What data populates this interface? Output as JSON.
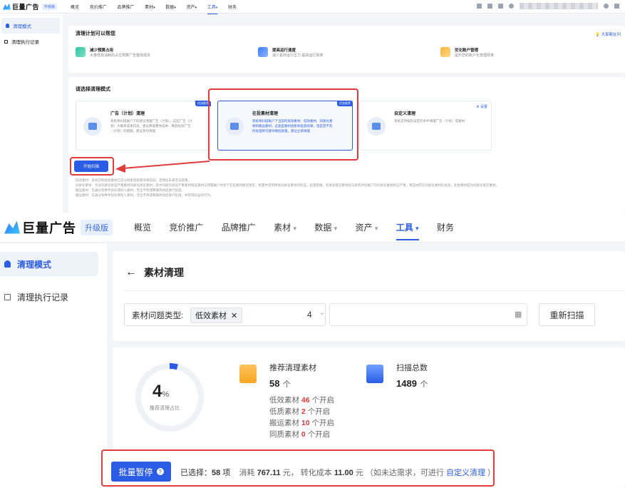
{
  "small": {
    "brand": "巨量广告",
    "badge": "升级版",
    "nav": [
      "概览",
      "竞价推广",
      "品牌推广",
      "素材",
      "数据",
      "资产",
      "工具",
      "财务"
    ],
    "nav_arrows": {
      "素材": "▾",
      "数据": "▾",
      "资产": "▾",
      "工具": "▾"
    },
    "sidebar": [
      {
        "label": "清理模式"
      },
      {
        "label": "清理执行记录"
      }
    ],
    "help_title": "清理计划可以帮您",
    "help_link": "大家都在问",
    "features": [
      {
        "title": "减少预算占用",
        "desc": "大量低效消耗的占位预算广告整体成本"
      },
      {
        "title": "提高运行速度",
        "desc": "减少素材运行压力 提高运行效率"
      },
      {
        "title": "优化账户管理",
        "desc": "提升您的账户化管理效率"
      }
    ],
    "select_title": "请选择清理模式",
    "cards": [
      {
        "tag": "优选推荐",
        "title": "广告（计划）清理",
        "desc": "系统将扫描账户下的建议清理广告（计划），这些广告（计划）大概率成本较高，建议降低整体成本，释放投放广告（计划）的配额。建议及时清理"
      },
      {
        "tag": "优选推荐",
        "title": "在投素材清理",
        "desc": "系统将扫描账户下当前的低效素材、低效素材、同质化素材和搬运素材，这类型素材会影响投放效果，但是若不及时处理将可能导致低质量。建议立即清理"
      },
      {
        "settings": "设置",
        "title": "自定义清理",
        "desc": "系统支持按您设定的条件清理广告（计划）或素材"
      }
    ],
    "start_button": "开始扫描",
    "notes": [
      "低效素材：系统识别低效素材已充分探索但跑量效果较低，且预估未来无法提量。",
      "同质化素材：包含同质化拆压严重素材同质化接近素材；其中同质化拆压严重素材指该素材与所属账户中多个在投素材极近接近，抢量中受到降低同质化素材的拆压，起量困难，同质化接近素材指与系统评估账户内同质化素材拆压严重，将自动开启同质化素材队投放，此类素材成为同质化接近素材。",
      "搬运素材：实通过各种手段抄袭别人素材，完全不改或略微改动后进行投放。",
      "搬运素材：实通过各种手段抄袭别人素材，完全不改或略微改动后进行投放，并获得权益的行为。"
    ]
  },
  "large": {
    "brand": "巨量广告",
    "badge": "升级版",
    "nav": [
      "概览",
      "竞价推广",
      "品牌推广",
      "素材",
      "数据",
      "资产",
      "工具",
      "财务"
    ],
    "nav_arrows": {
      "素材": "▾",
      "数据": "▾",
      "资产": "▾",
      "工具": "▾"
    },
    "sidebar": [
      {
        "label": "清理模式"
      },
      {
        "label": "清理执行记录"
      }
    ],
    "page_title": "素材清理",
    "filter_label": "素材问题类型:",
    "filter_chip": "低效素材",
    "count": "4",
    "rescan": "重新扫描",
    "percent": "4",
    "percent_unit": "%",
    "percent_progress": 0.04,
    "percent_label": "推荐清理占比",
    "recommend": {
      "label": "推荐清理素材",
      "total": "58",
      "unit": "个",
      "items": [
        {
          "name": "低效素材",
          "count": "46",
          "suffix": "个开启"
        },
        {
          "name": "低质素材",
          "count": "2",
          "suffix": "个开启"
        },
        {
          "name": "搬运素材",
          "count": "10",
          "suffix": "个开启"
        },
        {
          "name": "同质素材",
          "count": "0",
          "suffix": "个开启"
        }
      ]
    },
    "scan": {
      "label": "扫描总数",
      "total": "1489",
      "unit": "个"
    },
    "bottom": {
      "button": "批量暂停",
      "selected_label": "已选择：",
      "selected_count": "58",
      "selected_unit": "项",
      "cost_label": "消耗",
      "cost": "767.11",
      "cost_unit": "元，",
      "conv_label": "转化成本",
      "conv": "11.00",
      "conv_unit": "元",
      "hint_prefix": "（如未达需求，可进行",
      "hint_link": "自定义清理",
      "hint_suffix": "）"
    }
  },
  "colors": {
    "accent": "#2b5ce6",
    "annotation": "#e23b3b"
  }
}
